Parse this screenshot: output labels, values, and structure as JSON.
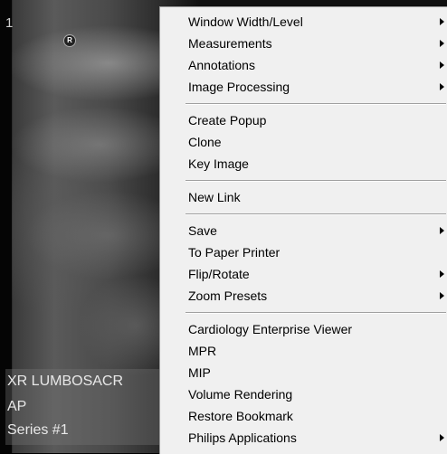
{
  "viewport": {
    "number": "1",
    "marker": "R",
    "overlay": [
      "XR LUMBOSACR",
      "AP",
      "Series #1"
    ]
  },
  "menu": {
    "groups": [
      [
        {
          "label": "Window Width/Level",
          "submenu": true
        },
        {
          "label": "Measurements",
          "submenu": true
        },
        {
          "label": "Annotations",
          "submenu": true
        },
        {
          "label": "Image Processing",
          "submenu": true
        }
      ],
      [
        {
          "label": "Create Popup",
          "submenu": false
        },
        {
          "label": "Clone",
          "submenu": false
        },
        {
          "label": "Key Image",
          "submenu": false
        }
      ],
      [
        {
          "label": "New Link",
          "submenu": false
        }
      ],
      [
        {
          "label": "Save",
          "submenu": true
        },
        {
          "label": "To Paper Printer",
          "submenu": false
        },
        {
          "label": "Flip/Rotate",
          "submenu": true
        },
        {
          "label": "Zoom Presets",
          "submenu": true
        }
      ],
      [
        {
          "label": "Cardiology Enterprise Viewer",
          "submenu": false
        },
        {
          "label": "MPR",
          "submenu": false
        },
        {
          "label": "MIP",
          "submenu": false
        },
        {
          "label": "Volume Rendering",
          "submenu": false
        },
        {
          "label": "Restore Bookmark",
          "submenu": false
        },
        {
          "label": "Philips Applications",
          "submenu": true
        }
      ]
    ]
  }
}
